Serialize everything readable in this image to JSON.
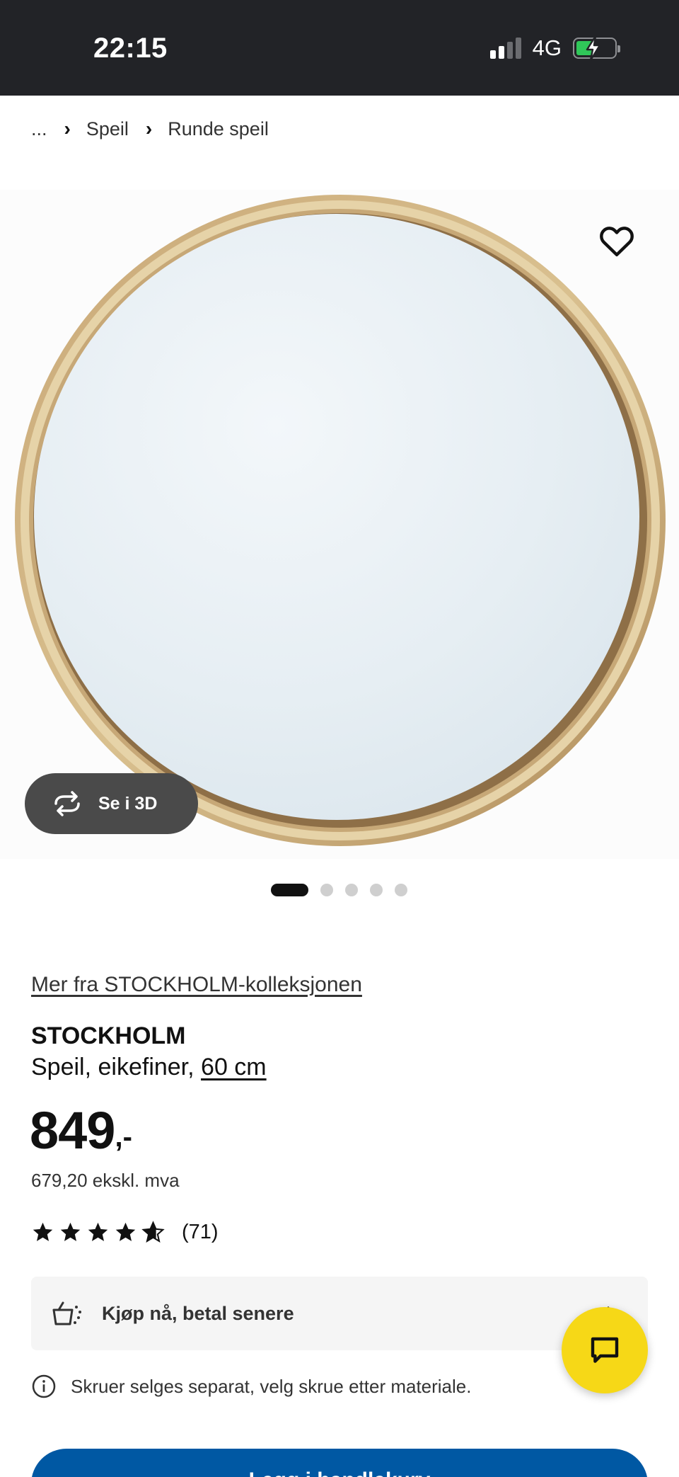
{
  "status_bar": {
    "time": "22:15",
    "network": "4G",
    "battery_level": 0.5,
    "battery_color": "#30c759"
  },
  "breadcrumb": {
    "ellipsis": "...",
    "items": [
      "Speil",
      "Runde speil"
    ]
  },
  "gallery": {
    "view_3d_label": "Se i 3D",
    "image_count": 5,
    "active_index": 0
  },
  "product": {
    "collection_link": "Mer fra STOCKHOLM-kolleksjonen",
    "name": "STOCKHOLM",
    "description": "Speil, eikefiner, ",
    "size": "60 cm",
    "price": "849",
    "price_suffix": ",-",
    "price_ex_vat": "679,20 ekskl. mva",
    "rating": 4.7,
    "rating_max": 5,
    "review_count": "(71)"
  },
  "pay_later": {
    "label": "Kjøp nå, betal senere"
  },
  "notice": {
    "text": "Skruer selges separat, velg skrue etter materiale."
  },
  "cta": {
    "label": "Legg i handlekurv"
  },
  "colors": {
    "brand_blue": "#0058a3",
    "chat_yellow": "#f6d817",
    "status_bar_bg": "#222327"
  },
  "icons": {
    "favorite": "heart-icon",
    "view_3d": "rotate-3d-icon",
    "pay_later": "basket-icon",
    "info": "info-icon",
    "chat": "chat-icon"
  }
}
